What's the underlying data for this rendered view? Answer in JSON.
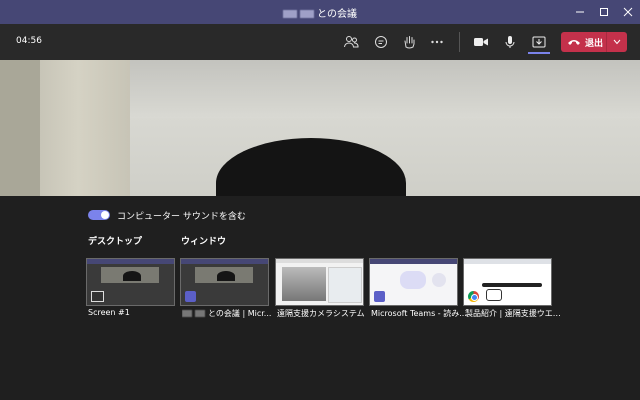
{
  "window": {
    "title_suffix": "との会議"
  },
  "toolbar": {
    "timer": "04:56",
    "leave_label": "退出",
    "icons": [
      "participants-icon",
      "chat-icon",
      "raise-hand-icon",
      "more-icon",
      "camera-icon",
      "mic-icon",
      "share-icon",
      "phone-icon",
      "chevron-down-icon"
    ]
  },
  "share": {
    "toggle_label": "コンピューター サウンドを含む",
    "toggle_on": true,
    "desktop_heading": "デスクトップ",
    "window_heading": "ウィンドウ",
    "items": [
      {
        "label": "Screen #1"
      },
      {
        "label": "との会議 | Micr..."
      },
      {
        "label": "遠隔支援カメラシステム"
      },
      {
        "label": "Microsoft Teams - 読み..."
      },
      {
        "label": "製品紹介 | 遠隔支援ウエア..."
      }
    ]
  },
  "colors": {
    "titlebar": "#464775",
    "accent": "#7b83eb",
    "leave": "#c4314b"
  }
}
